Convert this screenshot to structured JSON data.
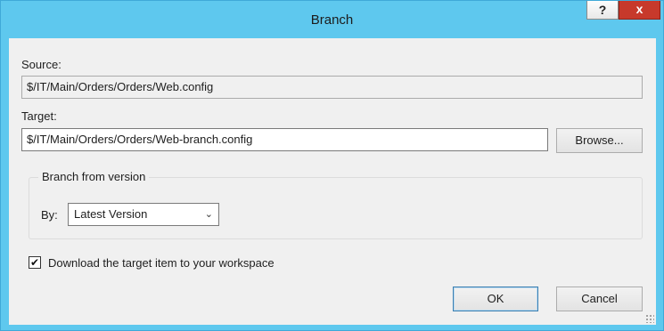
{
  "window": {
    "title": "Branch"
  },
  "titlebar": {
    "help_label": "?",
    "close_label": "x"
  },
  "source": {
    "label": "Source:",
    "value": "$/IT/Main/Orders/Orders/Web.config"
  },
  "target": {
    "label": "Target:",
    "value": "$/IT/Main/Orders/Orders/Web-branch.config",
    "browse_label": "Browse..."
  },
  "branch_from_version": {
    "group_title": "Branch from version",
    "by_label": "By:",
    "selected": "Latest Version"
  },
  "options": {
    "download_label": "Download the target item to your workspace",
    "download_checked": true,
    "check_glyph": "✔"
  },
  "footer": {
    "ok_label": "OK",
    "cancel_label": "Cancel"
  },
  "colors": {
    "titlebar": "#5ec8ee",
    "close": "#c7392b",
    "client": "#f0f0f0"
  }
}
